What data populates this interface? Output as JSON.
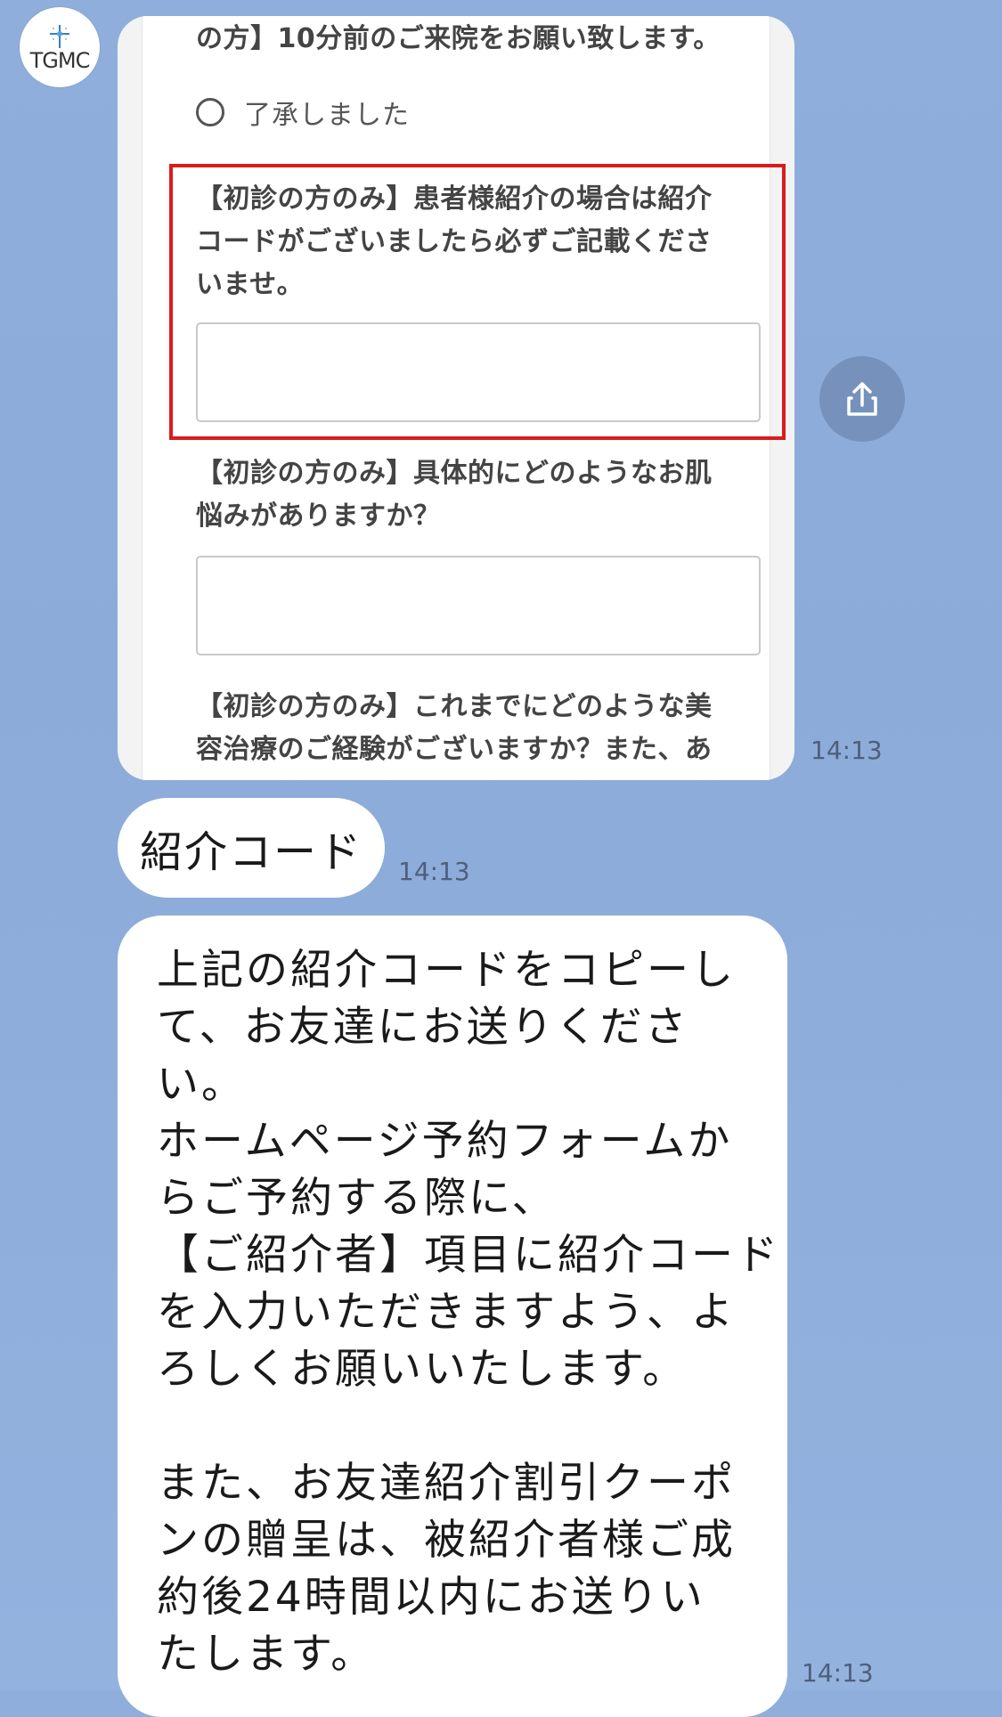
{
  "avatar": {
    "logo_text": "TGMC"
  },
  "form_screenshot": {
    "top_notice": "の方】10分前のご来院をお願い致します。",
    "radio_label": "了承しました",
    "q1_lines": [
      "【初診の方のみ】患者様紹介の場合は紹介",
      "コードがございましたら必ずご記載くださ",
      "いませ。"
    ],
    "q2_lines": [
      "【初診の方のみ】具体的にどのようなお肌",
      "悩みがありますか？"
    ],
    "q3_lines": [
      "【初診の方のみ】これまでにどのような美",
      "容治療のご経験がございますか？また、あ"
    ]
  },
  "colors": {
    "highlight": "#d81c1c",
    "background": "#8dabd9"
  },
  "messages": {
    "image_time": "14:13",
    "short_text": "紹介コード",
    "short_time": "14:13",
    "long_lines": [
      "上記の紹介コードをコピーし",
      "て、お友達にお送りくださ",
      "い。",
      "ホームページ予約フォームか",
      "らご予約する際に、",
      "【ご紹介者】項目に紹介コード",
      "を入力いただきますよう、よ",
      "ろしくお願いいたします。",
      "",
      "また、お友達紹介割引クーポ",
      "ンの贈呈は、被紹介者様ご成",
      "約後24時間以内にお送りい",
      "たします。"
    ],
    "long_time": "14:13"
  },
  "icons": {
    "share": "share-icon",
    "logo": "tgmc-logo-icon"
  }
}
